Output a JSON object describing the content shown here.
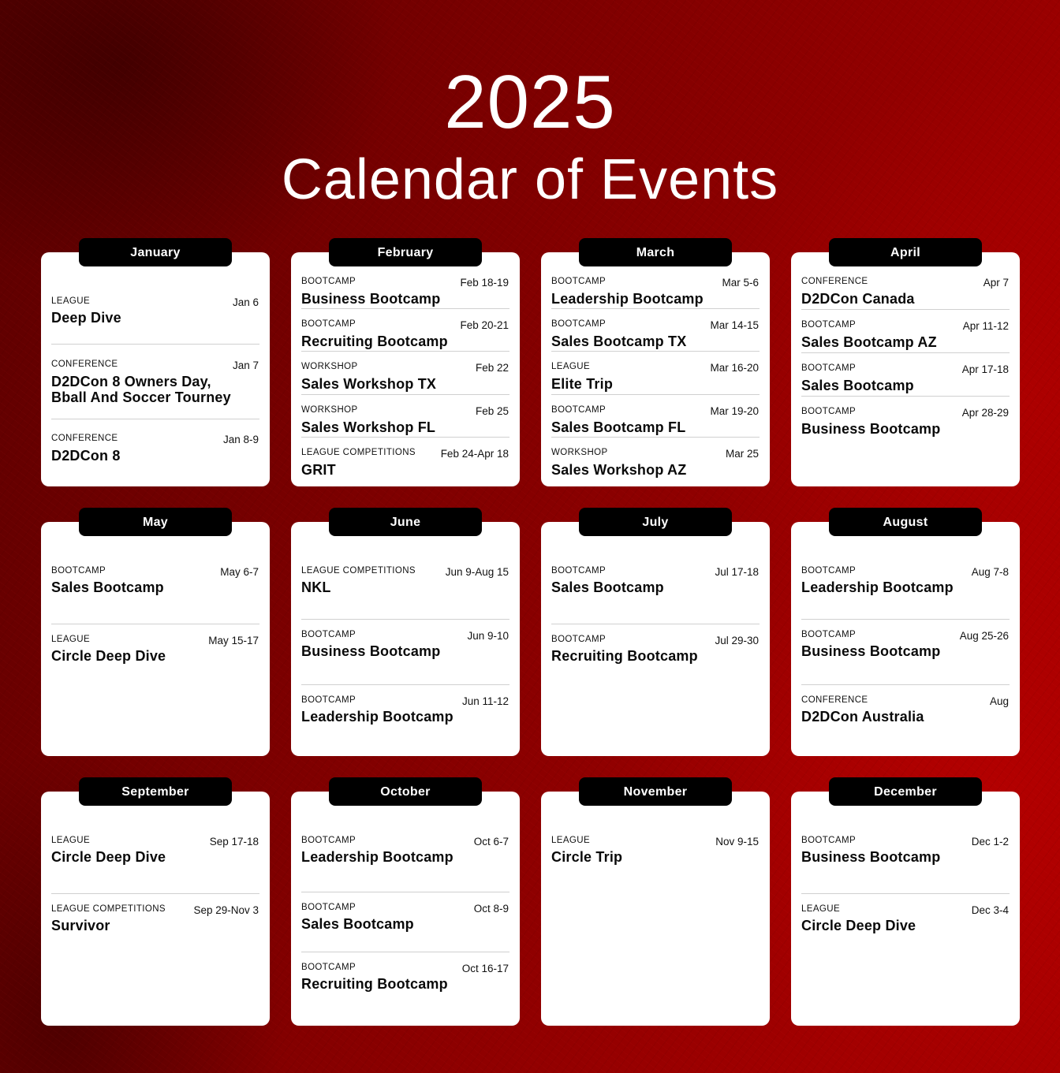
{
  "header": {
    "year": "2025",
    "subtitle": "Calendar of Events"
  },
  "colors": {
    "background_dark": "#5a0000",
    "background_bright": "#a80000",
    "card": "#ffffff",
    "tab": "#000000",
    "divider": "#d0d0d0"
  },
  "months": [
    {
      "name": "January",
      "events": [
        {
          "category": "LEAGUE",
          "date": "Jan 6",
          "title": "Deep Dive"
        },
        {
          "category": "CONFERENCE",
          "date": "Jan 7",
          "title": "D2DCon 8 Owners Day, Bball And Soccer Tourney"
        },
        {
          "category": "CONFERENCE",
          "date": "Jan 8-9",
          "title": "D2DCon 8"
        }
      ]
    },
    {
      "name": "February",
      "events": [
        {
          "category": "BOOTCAMP",
          "date": "Feb 18-19",
          "title": "Business Bootcamp"
        },
        {
          "category": "BOOTCAMP",
          "date": "Feb 20-21",
          "title": "Recruiting Bootcamp"
        },
        {
          "category": "WORKSHOP",
          "date": "Feb 22",
          "title": "Sales Workshop TX"
        },
        {
          "category": "WORKSHOP",
          "date": "Feb 25",
          "title": "Sales Workshop FL"
        },
        {
          "category": "LEAGUE COMPETITIONS",
          "date": "Feb 24-Apr 18",
          "title": "GRIT"
        }
      ]
    },
    {
      "name": "March",
      "events": [
        {
          "category": "BOOTCAMP",
          "date": "Mar 5-6",
          "title": "Leadership Bootcamp"
        },
        {
          "category": "BOOTCAMP",
          "date": "Mar 14-15",
          "title": "Sales Bootcamp TX"
        },
        {
          "category": "LEAGUE",
          "date": "Mar 16-20",
          "title": "Elite Trip"
        },
        {
          "category": "BOOTCAMP",
          "date": "Mar 19-20",
          "title": "Sales Bootcamp FL"
        },
        {
          "category": "WORKSHOP",
          "date": "Mar 25",
          "title": "Sales Workshop AZ"
        }
      ]
    },
    {
      "name": "April",
      "events": [
        {
          "category": "CONFERENCE",
          "date": "Apr 7",
          "title": "D2DCon Canada"
        },
        {
          "category": "BOOTCAMP",
          "date": "Apr 11-12",
          "title": "Sales Bootcamp AZ"
        },
        {
          "category": "BOOTCAMP",
          "date": "Apr 17-18",
          "title": "Sales Bootcamp"
        },
        {
          "category": "BOOTCAMP",
          "date": "Apr 28-29",
          "title": "Business Bootcamp"
        }
      ]
    },
    {
      "name": "May",
      "events": [
        {
          "category": "BOOTCAMP",
          "date": "May 6-7",
          "title": "Sales Bootcamp"
        },
        {
          "category": "LEAGUE",
          "date": "May 15-17",
          "title": "Circle Deep Dive"
        }
      ]
    },
    {
      "name": "June",
      "events": [
        {
          "category": "LEAGUE COMPETITIONS",
          "date": "Jun 9-Aug 15",
          "title": "NKL"
        },
        {
          "category": "BOOTCAMP",
          "date": "Jun 9-10",
          "title": "Business Bootcamp"
        },
        {
          "category": "BOOTCAMP",
          "date": "Jun 11-12",
          "title": "Leadership Bootcamp"
        }
      ]
    },
    {
      "name": "July",
      "events": [
        {
          "category": "BOOTCAMP",
          "date": "Jul 17-18",
          "title": "Sales Bootcamp"
        },
        {
          "category": "BOOTCAMP",
          "date": "Jul 29-30",
          "title": "Recruiting Bootcamp"
        }
      ]
    },
    {
      "name": "August",
      "events": [
        {
          "category": "BOOTCAMP",
          "date": "Aug 7-8",
          "title": "Leadership Bootcamp"
        },
        {
          "category": "BOOTCAMP",
          "date": "Aug 25-26",
          "title": "Business Bootcamp"
        },
        {
          "category": "CONFERENCE",
          "date": "Aug",
          "title": "D2DCon Australia"
        }
      ]
    },
    {
      "name": "September",
      "events": [
        {
          "category": "LEAGUE",
          "date": "Sep 17-18",
          "title": "Circle Deep Dive"
        },
        {
          "category": "LEAGUE COMPETITIONS",
          "date": "Sep 29-Nov 3",
          "title": "Survivor"
        }
      ]
    },
    {
      "name": "October",
      "events": [
        {
          "category": "BOOTCAMP",
          "date": "Oct 6-7",
          "title": "Leadership Bootcamp"
        },
        {
          "category": "BOOTCAMP",
          "date": "Oct 8-9",
          "title": "Sales Bootcamp"
        },
        {
          "category": "BOOTCAMP",
          "date": "Oct 16-17",
          "title": "Recruiting Bootcamp"
        }
      ]
    },
    {
      "name": "November",
      "events": [
        {
          "category": "LEAGUE",
          "date": "Nov 9-15",
          "title": "Circle Trip"
        }
      ]
    },
    {
      "name": "December",
      "events": [
        {
          "category": "BOOTCAMP",
          "date": "Dec 1-2",
          "title": "Business Bootcamp"
        },
        {
          "category": "LEAGUE",
          "date": "Dec 3-4",
          "title": "Circle Deep Dive"
        }
      ]
    }
  ]
}
